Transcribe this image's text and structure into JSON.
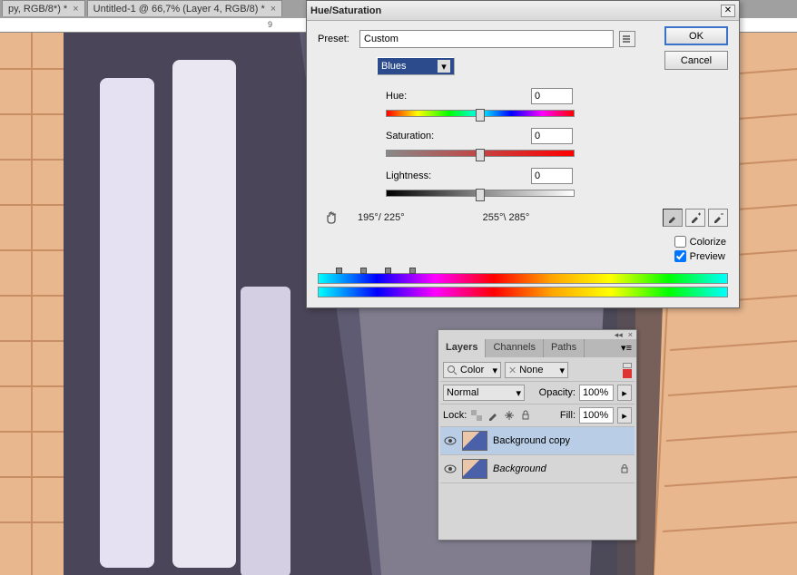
{
  "tabs": [
    {
      "label": "py, RGB/8*) *"
    },
    {
      "label": "Untitled-1 @ 66,7% (Layer 4, RGB/8) *"
    }
  ],
  "ruler": {
    "label_9": "9"
  },
  "dialog": {
    "title": "Hue/Saturation",
    "preset_label": "Preset:",
    "preset_value": "Custom",
    "ok": "OK",
    "cancel": "Cancel",
    "channel": "Blues",
    "hue_label": "Hue:",
    "hue_value": "0",
    "sat_label": "Saturation:",
    "sat_value": "0",
    "light_label": "Lightness:",
    "light_value": "0",
    "range_left": "195°/ 225°",
    "range_right": "255°\\ 285°",
    "colorize": "Colorize",
    "preview": "Preview"
  },
  "layers_panel": {
    "tabs": {
      "layers": "Layers",
      "channels": "Channels",
      "paths": "Paths"
    },
    "filter_label": "Color",
    "filter2_label": "None",
    "blend_mode": "Normal",
    "opacity_label": "Opacity:",
    "opacity_value": "100%",
    "lock_label": "Lock:",
    "fill_label": "Fill:",
    "fill_value": "100%",
    "layers": [
      {
        "name": "Background copy",
        "locked": false,
        "selected": true
      },
      {
        "name": "Background",
        "locked": true,
        "selected": false
      }
    ]
  }
}
